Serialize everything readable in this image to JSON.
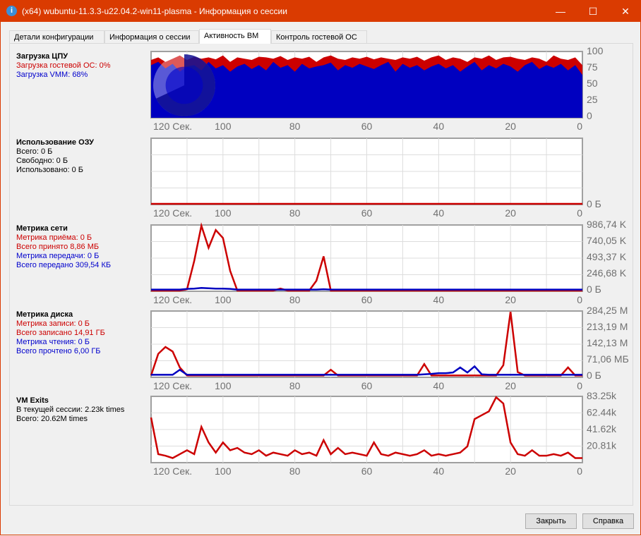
{
  "window": {
    "title": "(x64) wubuntu-11.3.3-u22.04.2-win11-plasma - Информация о сессии",
    "minimize": "—",
    "maximize": "☐",
    "close": "✕"
  },
  "tabs": [
    {
      "label": "Детали конфигурации"
    },
    {
      "label": "Информация о сессии"
    },
    {
      "label": "Активность ВМ",
      "active": true
    },
    {
      "label": "Контроль гостевой ОС"
    }
  ],
  "colors": {
    "red": "#cc0000",
    "blue": "#0000c0",
    "title": "#da3b01"
  },
  "x_ticks": [
    "120 Сек.",
    "100",
    "80",
    "60",
    "40",
    "20",
    "0"
  ],
  "cpu": {
    "title": "Загрузка ЦПУ",
    "guest": "Загрузка гостевой ОС: 0%",
    "vmm": "Загрузка VMM: 68%"
  },
  "ram": {
    "title": "Использование ОЗУ",
    "total": "Всего: 0 Б",
    "free": "Свободно: 0 Б",
    "used": "Использовано: 0 Б"
  },
  "net": {
    "title": "Метрика сети",
    "rx": "Метрика приёма: 0 Б",
    "rx_total": "Всего принято 8,86 МБ",
    "tx": "Метрика передачи: 0 Б",
    "tx_total": "Всего передано 309,54 КБ"
  },
  "disk": {
    "title": "Метрика диска",
    "w": "Метрика записи: 0 Б",
    "w_total": "Всего записано 14,91 ГБ",
    "r": "Метрика чтения: 0 Б",
    "r_total": "Всего прочтено 6,00 ГБ"
  },
  "exits": {
    "title": "VM Exits",
    "session": "В текущей сессии: 2.23k times",
    "total": "Всего: 20.62M times"
  },
  "buttons": {
    "close": "Закрыть",
    "help": "Справка"
  },
  "chart_data": [
    {
      "type": "area",
      "name": "cpu",
      "ylim": [
        0,
        100
      ],
      "y_ticks": [
        "100",
        "75",
        "50",
        "25",
        "0"
      ],
      "pie_value": 68,
      "series": [
        {
          "name": "guest",
          "color": "#cc0000",
          "values": [
            88,
            92,
            85,
            90,
            95,
            88,
            93,
            90,
            92,
            89,
            95,
            85,
            92,
            90,
            88,
            93,
            92,
            90,
            94,
            88,
            92,
            90,
            93,
            85,
            92,
            95,
            90,
            88,
            92,
            90,
            93,
            89,
            92,
            90,
            88,
            92,
            90,
            93,
            87,
            92,
            95,
            88,
            92,
            90,
            85,
            92,
            90,
            95,
            88,
            92,
            93,
            90,
            88,
            92,
            90,
            85,
            95,
            90,
            88,
            92,
            80
          ]
        },
        {
          "name": "vmm",
          "color": "#0000c0",
          "values": [
            80,
            85,
            75,
            82,
            70,
            78,
            80,
            72,
            85,
            75,
            80,
            70,
            78,
            82,
            74,
            80,
            72,
            85,
            76,
            80,
            70,
            82,
            75,
            78,
            80,
            84,
            72,
            80,
            76,
            82,
            78,
            74,
            80,
            85,
            70,
            82,
            76,
            80,
            72,
            78,
            82,
            75,
            80,
            70,
            78,
            85,
            72,
            80,
            75,
            82,
            78,
            70,
            80,
            85,
            74,
            80,
            76,
            82,
            72,
            80,
            65
          ]
        }
      ]
    },
    {
      "type": "line",
      "name": "ram",
      "ylim": [
        0,
        1
      ],
      "y_ticks": [
        "0 Б"
      ],
      "series": [
        {
          "name": "used",
          "color": "#cc0000",
          "values": [
            0,
            0
          ]
        }
      ]
    },
    {
      "type": "line",
      "name": "net",
      "ylim": [
        0,
        986.74
      ],
      "y_ticks": [
        "986,74 K",
        "740,05 K",
        "493,37 K",
        "246,68 K",
        "0 Б"
      ],
      "series": [
        {
          "name": "rx",
          "color": "#cc0000",
          "values": [
            0,
            0,
            0,
            0,
            0,
            20,
            450,
            986,
            650,
            920,
            800,
            300,
            0,
            0,
            0,
            0,
            0,
            0,
            30,
            0,
            0,
            0,
            0,
            150,
            520,
            0,
            0,
            0,
            0,
            0,
            0,
            0,
            0,
            0,
            0,
            0,
            0,
            0,
            0,
            0,
            0,
            0,
            0,
            0,
            0,
            0,
            0,
            0,
            0,
            0,
            0,
            0,
            0,
            0,
            0,
            0,
            0,
            0,
            0,
            0,
            0
          ]
        },
        {
          "name": "tx",
          "color": "#0000c0",
          "values": [
            15,
            15,
            15,
            15,
            15,
            25,
            30,
            40,
            35,
            30,
            30,
            25,
            15,
            15,
            15,
            15,
            15,
            15,
            15,
            15,
            15,
            15,
            15,
            15,
            20,
            15,
            15,
            15,
            15,
            15,
            15,
            15,
            15,
            15,
            15,
            15,
            15,
            15,
            15,
            15,
            15,
            15,
            15,
            15,
            15,
            15,
            15,
            15,
            15,
            15,
            15,
            15,
            15,
            15,
            15,
            15,
            15,
            15,
            15,
            15,
            15
          ]
        }
      ]
    },
    {
      "type": "line",
      "name": "disk",
      "ylim": [
        0,
        284.25
      ],
      "y_ticks": [
        "284,25 M",
        "213,19 M",
        "142,13 M",
        "71,06 МБ",
        "0 Б"
      ],
      "series": [
        {
          "name": "write",
          "color": "#cc0000",
          "values": [
            5,
            100,
            130,
            110,
            40,
            5,
            5,
            5,
            5,
            5,
            5,
            5,
            5,
            5,
            5,
            5,
            5,
            5,
            5,
            5,
            5,
            5,
            5,
            5,
            5,
            30,
            5,
            5,
            5,
            5,
            5,
            5,
            5,
            5,
            5,
            5,
            5,
            5,
            55,
            5,
            5,
            5,
            5,
            5,
            5,
            5,
            5,
            5,
            5,
            50,
            284,
            20,
            5,
            5,
            5,
            5,
            5,
            5,
            40,
            5,
            5
          ]
        },
        {
          "name": "read",
          "color": "#0000c0",
          "values": [
            8,
            8,
            8,
            8,
            30,
            8,
            8,
            8,
            8,
            8,
            8,
            8,
            8,
            8,
            8,
            8,
            8,
            8,
            8,
            8,
            8,
            8,
            8,
            8,
            8,
            8,
            8,
            8,
            8,
            8,
            8,
            8,
            8,
            8,
            8,
            8,
            8,
            8,
            10,
            12,
            15,
            15,
            18,
            40,
            18,
            45,
            10,
            8,
            8,
            8,
            8,
            8,
            8,
            8,
            8,
            8,
            8,
            8,
            8,
            8,
            8
          ]
        }
      ]
    },
    {
      "type": "line",
      "name": "exits",
      "ylim": [
        0,
        83.25
      ],
      "y_ticks": [
        "83.25k",
        "62.44k",
        "41.62k",
        "20.81k"
      ],
      "series": [
        {
          "name": "exits",
          "color": "#cc0000",
          "values": [
            57,
            10,
            8,
            5,
            10,
            15,
            10,
            45,
            25,
            12,
            25,
            15,
            18,
            12,
            10,
            15,
            8,
            12,
            10,
            8,
            15,
            10,
            12,
            8,
            28,
            10,
            18,
            10,
            12,
            10,
            8,
            25,
            10,
            8,
            12,
            10,
            8,
            10,
            15,
            8,
            10,
            8,
            10,
            12,
            20,
            55,
            60,
            65,
            83,
            75,
            25,
            10,
            8,
            15,
            8,
            8,
            10,
            8,
            12,
            5,
            5
          ]
        }
      ]
    }
  ]
}
